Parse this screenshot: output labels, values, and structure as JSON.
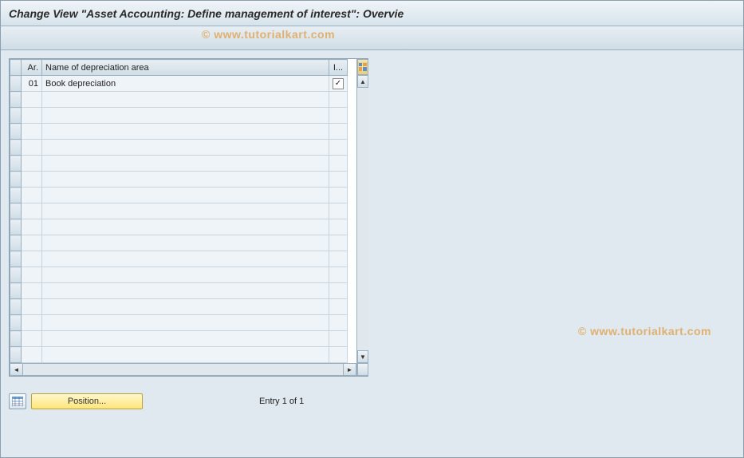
{
  "header": {
    "title": "Change View \"Asset Accounting: Define management of interest\": Overvie"
  },
  "watermark": "© www.tutorialkart.com",
  "table": {
    "columns": {
      "ar": "Ar.",
      "name": "Name of depreciation area",
      "check": "I..."
    },
    "rows": [
      {
        "ar": "01",
        "name": "Book depreciation",
        "checked": "✓"
      }
    ],
    "empty_row_count": 17
  },
  "footer": {
    "position_label": "Position...",
    "entry_text": "Entry 1 of 1"
  }
}
